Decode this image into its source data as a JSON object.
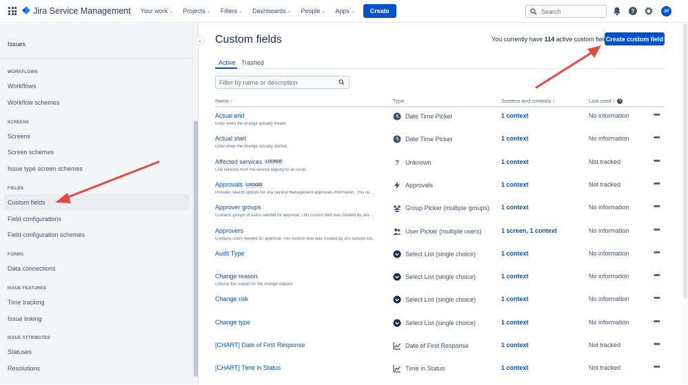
{
  "topnav": {
    "product": "Jira Service Management",
    "items": [
      {
        "label": "Your work"
      },
      {
        "label": "Projects"
      },
      {
        "label": "Filters"
      },
      {
        "label": "Dashboards"
      },
      {
        "label": "People"
      },
      {
        "label": "Apps"
      }
    ],
    "create_label": "Create",
    "search_placeholder": "Search",
    "avatar_initials": "JP",
    "brand_color": "#0052cc"
  },
  "sidebar": {
    "top_item": "Issues",
    "sections": [
      {
        "heading": "WORKFLOWS",
        "items": [
          "Workflows",
          "Workflow schemes"
        ]
      },
      {
        "heading": "SCREENS",
        "items": [
          "Screens",
          "Screen schemes",
          "Issue type screen schemes"
        ]
      },
      {
        "heading": "FIELDS",
        "items": [
          "Custom fields",
          "Field configurations",
          "Field configuration schemes"
        ]
      },
      {
        "heading": "FORMS",
        "items": [
          "Data connections"
        ]
      },
      {
        "heading": "ISSUE FEATURES",
        "items": [
          "Time tracking",
          "Issue linking"
        ]
      },
      {
        "heading": "ISSUE ATTRIBUTES",
        "items": [
          "Statuses",
          "Resolutions"
        ]
      }
    ],
    "active_item": "Custom fields"
  },
  "main": {
    "title": "Custom fields",
    "count_prefix": "You currently have",
    "count_value": "114",
    "count_suffix": "active custom fields",
    "create_button": "Create custom field",
    "tabs": [
      {
        "label": "Active"
      },
      {
        "label": "Trashed"
      }
    ],
    "filter_placeholder": "Filter by name or description",
    "columns": {
      "name": "Name",
      "type": "Type",
      "screens": "Screens and contexts",
      "last_used": "Last used"
    },
    "locked_label": "LOCKED",
    "rows": [
      {
        "name": "Actual end",
        "desc": "Enter when the change actually ended.",
        "type": "Date Time Picker",
        "type_icon": "clock-icon",
        "context": "1 context",
        "last_used": "No information"
      },
      {
        "name": "Actual start",
        "desc": "Enter when the change actually started.",
        "type": "Date Time Picker",
        "type_icon": "clock-icon",
        "context": "1 context",
        "last_used": "No information"
      },
      {
        "name": "Affected services",
        "locked": true,
        "desc": "Link services from the service registry to an issue.",
        "type": "Unknown",
        "type_icon": "question-icon",
        "context": "1 context",
        "last_used": "Not tracked"
      },
      {
        "name": "Approvals",
        "locked": true,
        "desc": "Provides search options for Jira Service Management approvals information. This cu...",
        "type": "Approvals",
        "type_icon": "lightning-icon",
        "context": "1 context",
        "last_used": "Not tracked"
      },
      {
        "name": "Approver groups",
        "desc": "Contains groups of users needed for approval. This custom field was created by Jira ...",
        "type": "Group Picker (multiple groups)",
        "type_icon": "group-icon",
        "context": "1 context",
        "last_used": "No information"
      },
      {
        "name": "Approvers",
        "desc": "Contains users needed for approval. This custom field was created by Jira Service De...",
        "type": "User Picker (multiple users)",
        "type_icon": "users-icon",
        "context": "1 screen, 1 context",
        "last_used": "No information"
      },
      {
        "name": "Audit Type",
        "desc": "",
        "type": "Select List (single choice)",
        "type_icon": "select-icon",
        "context": "1 context",
        "last_used": "No information"
      },
      {
        "name": "Change reason",
        "desc": "Choose the reason for the change request",
        "type": "Select List (single choice)",
        "type_icon": "select-icon",
        "context": "1 context",
        "last_used": "No information"
      },
      {
        "name": "Change risk",
        "desc": "",
        "type": "Select List (single choice)",
        "type_icon": "select-icon",
        "context": "1 context",
        "last_used": "No information"
      },
      {
        "name": "Change type",
        "desc": "",
        "type": "Select List (single choice)",
        "type_icon": "select-icon",
        "context": "1 context",
        "last_used": "No information"
      },
      {
        "name": "[CHART] Date of First Response",
        "desc": "",
        "type": "Date of First Response",
        "type_icon": "chart-icon",
        "context": "1 context",
        "last_used": "Not tracked"
      },
      {
        "name": "[CHART] Time in Status",
        "desc": "",
        "type": "Time in Status",
        "type_icon": "chart-icon",
        "context": "1 context",
        "last_used": "Not tracked"
      }
    ]
  },
  "annotation_color": "#e5483f"
}
